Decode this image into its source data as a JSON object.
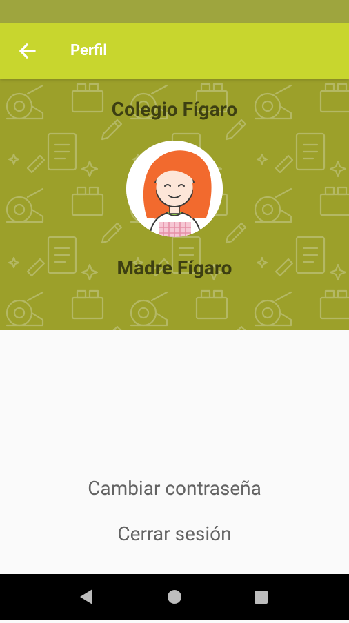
{
  "app_bar": {
    "title": "Perfil",
    "back_icon": "arrow-back-icon"
  },
  "colors": {
    "status_bar": "#9ea53e",
    "app_bar": "#c8d62e",
    "header": "#9ca02a",
    "header_text": "#3d3f12",
    "action_text": "#636363",
    "background": "#fafafa"
  },
  "profile": {
    "school": "Colegio Fígaro",
    "name": "Madre Fígaro",
    "avatar_icon": "woman-avatar-icon"
  },
  "actions": {
    "change_password": "Cambiar contraseña",
    "logout": "Cerrar sesión"
  },
  "nav": {
    "back": "triangle-back-icon",
    "home": "circle-home-icon",
    "recents": "square-recents-icon"
  }
}
